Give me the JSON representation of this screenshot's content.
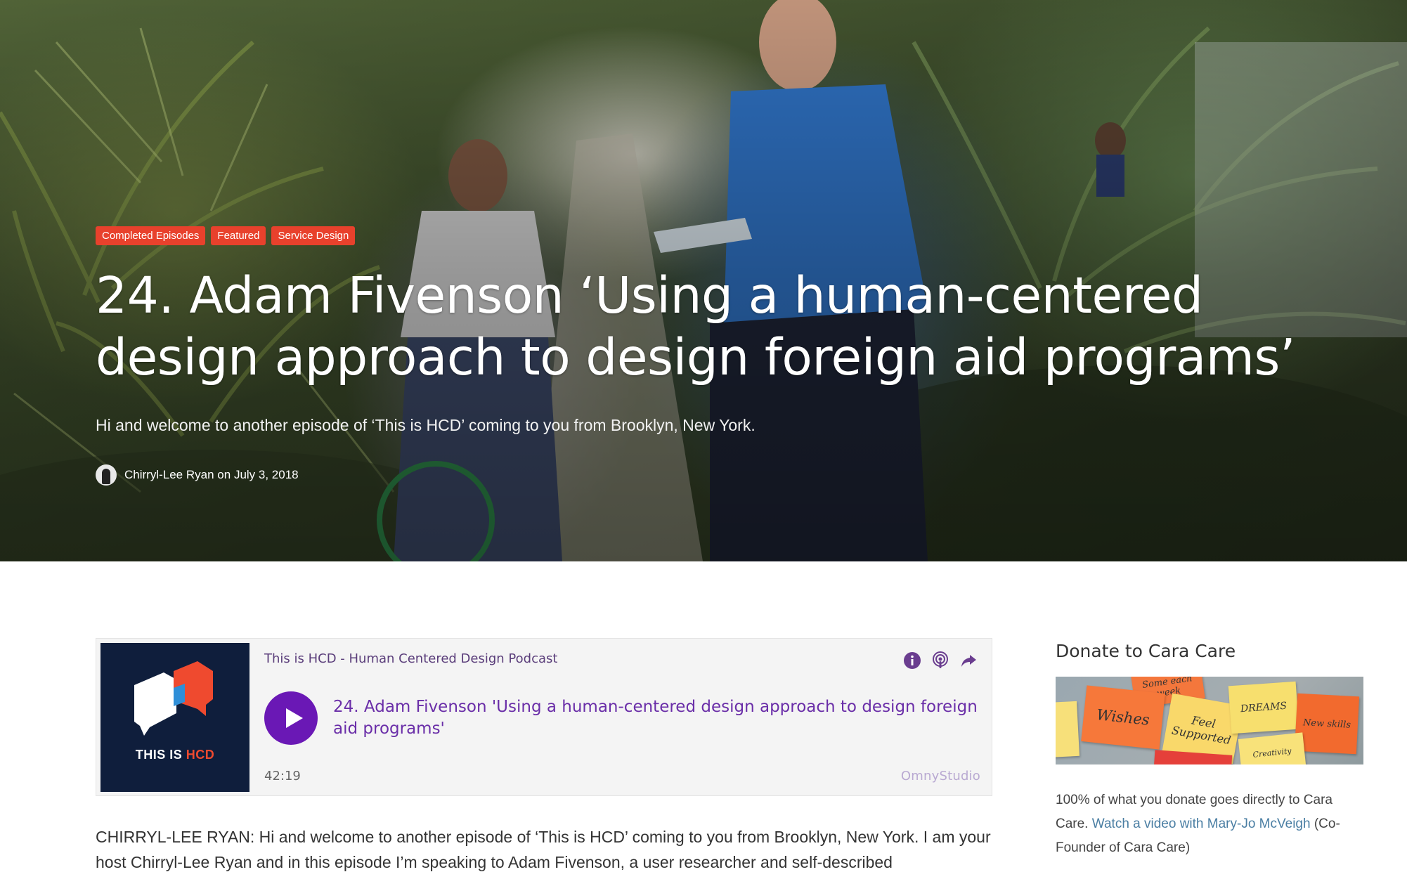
{
  "hero": {
    "tags": [
      "Completed Episodes",
      "Featured",
      "Service Design"
    ],
    "title": "24. Adam Fivenson ‘Using a human-centered design approach to design foreign aid programs’",
    "subtitle": "Hi and welcome to another episode of ‘This is HCD’ coming to you from Brooklyn, New York.",
    "author": "Chirryl-Lee Ryan",
    "date_prefix": "on",
    "date": "July 3, 2018"
  },
  "player": {
    "art_text_1": "THIS IS",
    "art_text_2": "HCD",
    "podcast_name": "This is HCD - Human Centered Design Podcast",
    "episode_title": "24. Adam Fivenson 'Using a human-centered design approach to design foreign aid programs'",
    "duration": "42:19",
    "brand": "OmnyStudio",
    "icons": [
      "info-icon",
      "podcast-icon",
      "share-icon"
    ],
    "accent_color": "#6a18b5"
  },
  "transcript": {
    "line1": "CHIRRYL-LEE RYAN: Hi and welcome to another episode of ‘This is HCD’ coming to you from Brooklyn, New York. I am",
    "line2": "your host Chirryl-Lee Ryan and in this episode I’m speaking to Adam Fivenson, a user researcher and self-described"
  },
  "sidebar": {
    "title": "Donate to Cara Care",
    "image_notes": [
      "Wishes",
      "Feel Supported",
      "DREAMS",
      "New skills",
      "Creativity",
      "Some each week"
    ],
    "text_1": "100% of what you donate goes directly to Cara Care. ",
    "link": "Watch a video with Mary-Jo McVeigh",
    "text_2": " (Co-Founder of Cara Care)"
  },
  "colors": {
    "tag_bg": "#e8412c",
    "link": "#4a7ea3",
    "artwork_bg": "#0f1e3c"
  }
}
